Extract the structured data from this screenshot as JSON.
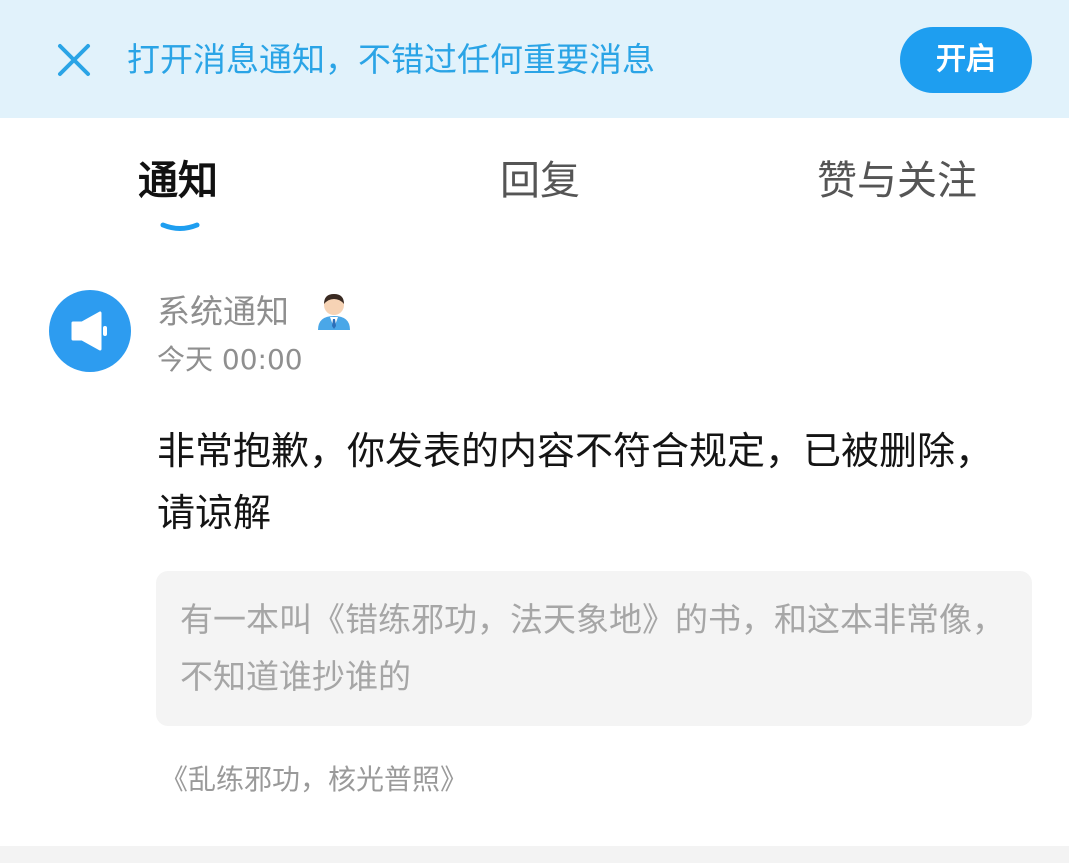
{
  "banner": {
    "message": "打开消息通知，不错过任何重要消息",
    "enable_button_label": "开启",
    "accent_color": "#1e9ef0"
  },
  "tabs": [
    {
      "label": "通知",
      "active": true
    },
    {
      "label": "回复",
      "active": false
    },
    {
      "label": "赞与关注",
      "active": false
    }
  ],
  "message": {
    "sender": "系统通知",
    "sender_icon": "megaphone-icon",
    "sender_badge_icon": "official-person-icon",
    "time": "今天 00:00",
    "body": "非常抱歉，你发表的内容不符合规定，已被删除，请谅解",
    "quoted_comment": "有一本叫《错练邪功，法天象地》的书，和这本非常像，不知道谁抄谁的",
    "source_title": "《乱练邪功，核光普照》"
  }
}
